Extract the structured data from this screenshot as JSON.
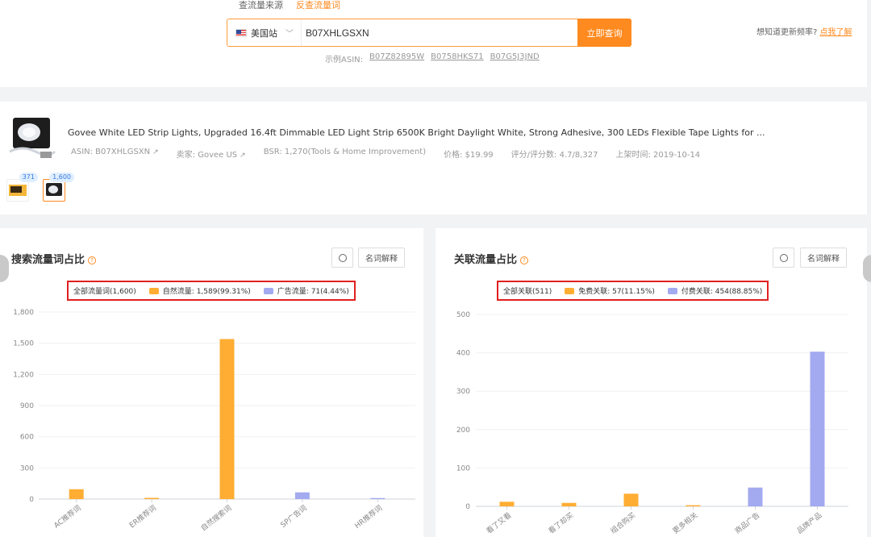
{
  "top": {
    "tabs": [
      "查流量来源",
      "反查流量词"
    ],
    "site_label": "美国站",
    "search_value": "B07XHLGSXN",
    "search_button": "立即查询",
    "examples_label": "示例ASIN:",
    "examples": [
      "B07Z82895W",
      "B0758HKS71",
      "B07G5J3JND"
    ],
    "help_text": "想知道更新频率?",
    "help_link": "点我了解"
  },
  "product": {
    "title": "Govee White LED Strip Lights, Upgraded 16.4ft Dimmable LED Light Strip 6500K Bright Daylight White, Strong Adhesive, 300 LEDs Flexible Tape Lights for ...",
    "asin": "ASIN: B07XHLGSXN",
    "seller": "卖家: Govee US",
    "bsr": "BSR: 1,270(Tools & Home Improvement)",
    "price": "价格: $19.99",
    "rating": "评分/评分数: 4.7/8,327",
    "launch": "上架时间: 2019-10-14",
    "variant_badges": [
      "371",
      "1,600"
    ]
  },
  "left_panel": {
    "title": "搜索流量词占比",
    "term_button": "名词解释",
    "legend": [
      "全部流量词(1,600)",
      "自然流量: 1,589(99.31%)",
      "广告流量: 71(4.44%)"
    ]
  },
  "right_panel": {
    "title": "关联流量占比",
    "term_button": "名词解释",
    "legend": [
      "全部关联(511)",
      "免费关联: 57(11.15%)",
      "付费关联: 454(88.85%)"
    ]
  },
  "colors": {
    "accent": "#ff8a1f",
    "organic": "#ffad33",
    "paid": "#a3aaf0",
    "highlight_border": "#e02020"
  },
  "chart_data": [
    {
      "type": "bar",
      "title": "搜索流量词占比",
      "categories": [
        "AC推荐词",
        "ER推荐词",
        "自然搜索词",
        "SP广告词",
        "HR推荐词"
      ],
      "colors": [
        "#ffad33",
        "#ffad33",
        "#ffad33",
        "#a3aaf0",
        "#a3aaf0"
      ],
      "values": [
        95,
        12,
        1540,
        65,
        10
      ],
      "yticks": [
        "0",
        "300",
        "600",
        "900",
        "1,200",
        "1,500",
        "1,800"
      ],
      "ylim": [
        0,
        1800
      ]
    },
    {
      "type": "bar",
      "title": "关联流量占比",
      "categories": [
        "看了又看",
        "看了却买",
        "组合购买",
        "更多相关",
        "商品广告",
        "品牌产品"
      ],
      "colors": [
        "#ffad33",
        "#ffad33",
        "#ffad33",
        "#ffad33",
        "#a3aaf0",
        "#a3aaf0"
      ],
      "values": [
        12,
        9,
        33,
        3,
        49,
        403
      ],
      "yticks": [
        "0",
        "100",
        "200",
        "300",
        "400",
        "500"
      ],
      "ylim": [
        0,
        500
      ]
    }
  ]
}
